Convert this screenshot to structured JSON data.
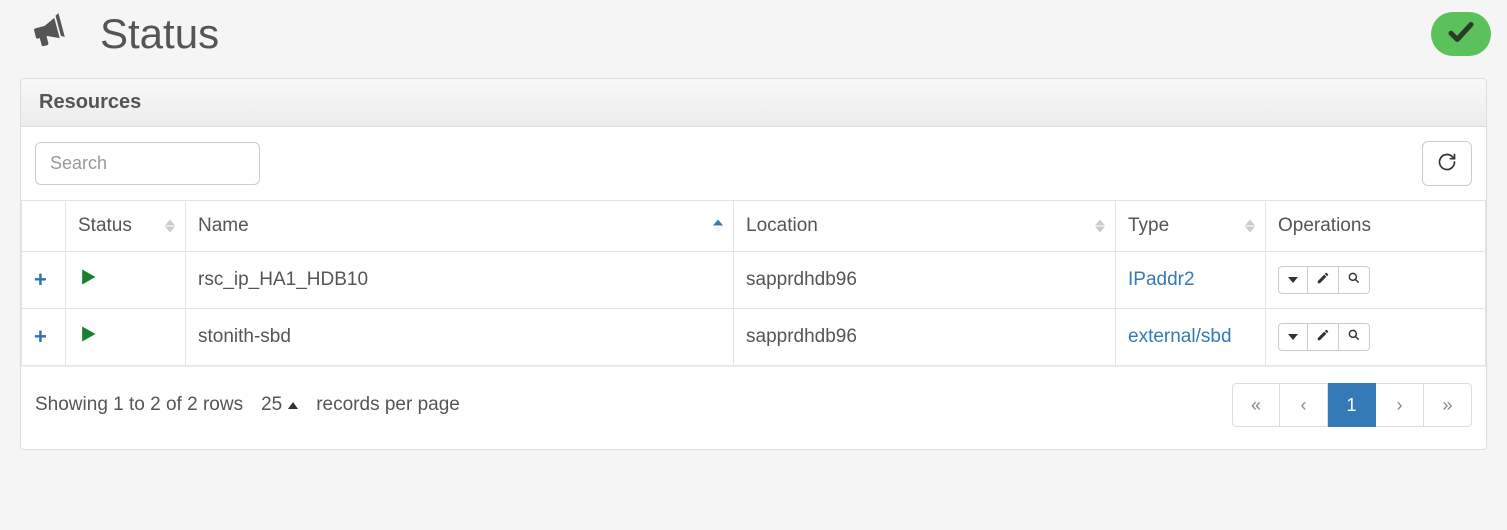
{
  "header": {
    "title": "Status"
  },
  "panel": {
    "heading": "Resources",
    "search_placeholder": "Search"
  },
  "columns": {
    "status": "Status",
    "name": "Name",
    "location": "Location",
    "type": "Type",
    "operations": "Operations"
  },
  "rows": [
    {
      "name": "rsc_ip_HA1_HDB10",
      "location": "sapprdhdb96",
      "type": "IPaddr2"
    },
    {
      "name": "stonith-sbd",
      "location": "sapprdhdb96",
      "type": "external/sbd"
    }
  ],
  "footer": {
    "summary": "Showing 1 to 2 of 2 rows",
    "page_size": "25",
    "records_label": "records per page",
    "current_page": "1"
  }
}
